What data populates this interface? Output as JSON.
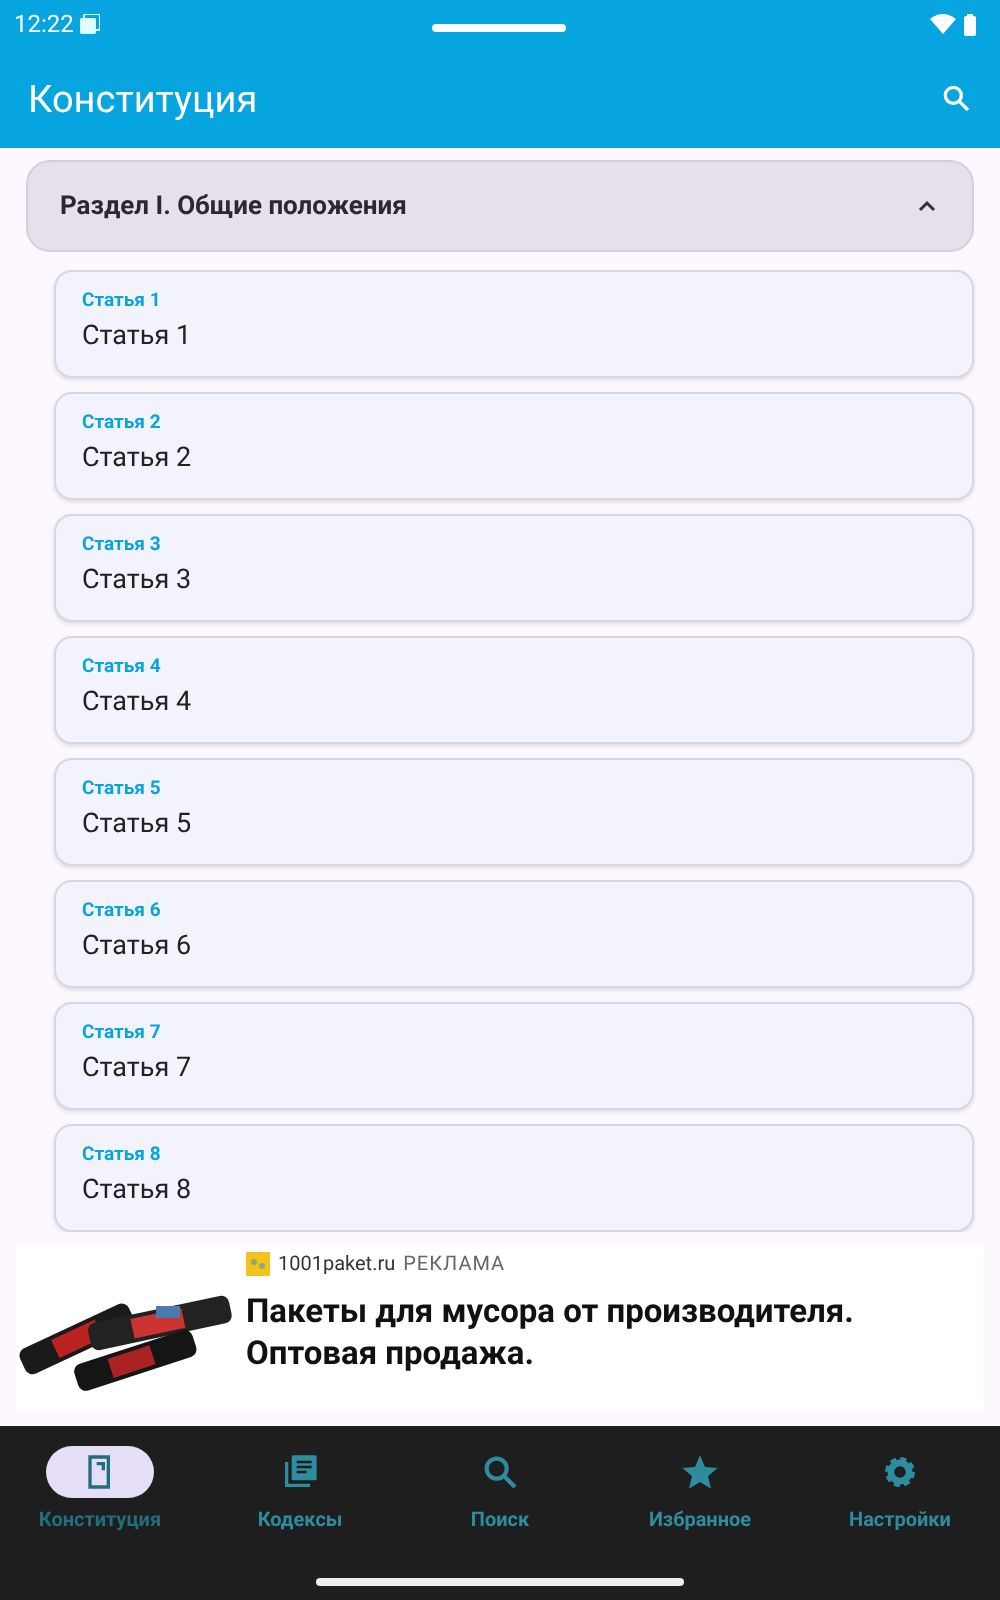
{
  "status_bar": {
    "time": "12:22"
  },
  "app_bar": {
    "title": "Конституция"
  },
  "section": {
    "title": "Раздел I. Общие положения",
    "expanded": true
  },
  "articles": [
    {
      "caption": "Статья 1",
      "title": "Статья 1"
    },
    {
      "caption": "Статья 2",
      "title": "Статья 2"
    },
    {
      "caption": "Статья 3",
      "title": "Статья 3"
    },
    {
      "caption": "Статья 4",
      "title": "Статья 4"
    },
    {
      "caption": "Статья 5",
      "title": "Статья 5"
    },
    {
      "caption": "Статья 6",
      "title": "Статья 6"
    },
    {
      "caption": "Статья 7",
      "title": "Статья 7"
    },
    {
      "caption": "Статья 8",
      "title": "Статья 8"
    }
  ],
  "ad": {
    "domain": "1001paket.ru",
    "label": "РЕКЛАМА",
    "text": "Пакеты для мусора от производителя. Оптовая продажа."
  },
  "bottom_nav": [
    {
      "label": "Конституция",
      "kind": "book",
      "selected": true
    },
    {
      "label": "Кодексы",
      "kind": "library",
      "selected": false
    },
    {
      "label": "Поиск",
      "kind": "search",
      "selected": false
    },
    {
      "label": "Избранное",
      "kind": "star",
      "selected": false
    },
    {
      "label": "Настройки",
      "kind": "gear",
      "selected": false
    }
  ]
}
